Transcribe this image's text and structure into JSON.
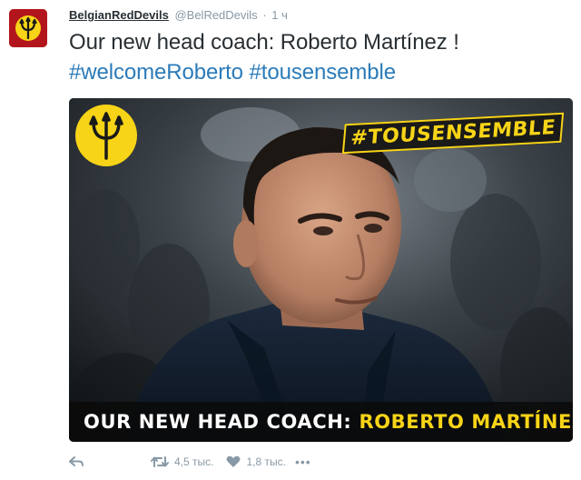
{
  "tweet": {
    "fullname": "BelgianRedDevils",
    "username": "@BelRedDevils",
    "separator": "·",
    "time": "1 ч",
    "text_line1": "Our new head coach: Roberto Martínez !",
    "hashtag1": "#welcomeRoberto",
    "hashtag2": "#tousensemble"
  },
  "media": {
    "badge_text": "#TOUSENSEMBLE",
    "caption_white": "OUR NEW HEAD COACH:",
    "caption_yellow": "ROBERTO MARTÍNEZ"
  },
  "actions": {
    "retweet_count": "4,5 тыс.",
    "favorite_count": "1,8 тыс.",
    "more_label": "•••"
  },
  "colors": {
    "brand_red": "#b3151d",
    "brand_yellow": "#f7d417",
    "link_blue": "#2b7bb9",
    "meta_gray": "#8899a6"
  },
  "icons": {
    "avatar": "trident-crest-icon",
    "reply": "reply-icon",
    "retweet": "retweet-icon",
    "favorite": "heart-icon",
    "more": "more-dots-icon"
  }
}
